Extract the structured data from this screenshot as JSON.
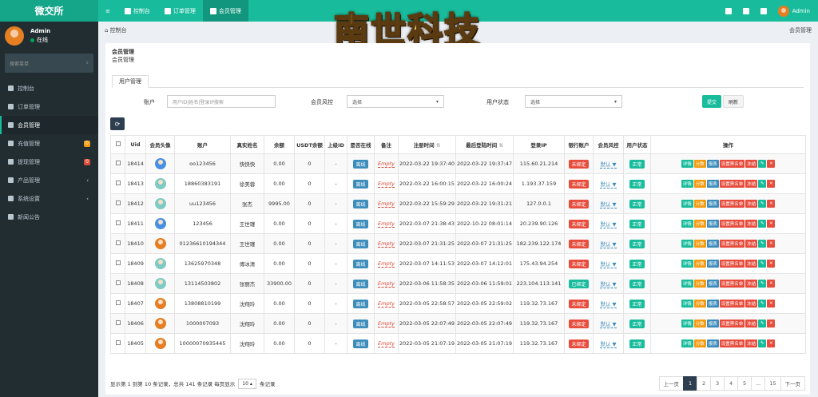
{
  "app": {
    "brand": "微交所"
  },
  "topnav": [
    {
      "label": "≡",
      "icon": "menu-icon"
    },
    {
      "label": "控制台",
      "icon": "dashboard-icon"
    },
    {
      "label": "订单管理",
      "icon": "list-icon"
    },
    {
      "label": "会员管理",
      "icon": "users-icon",
      "active": true
    }
  ],
  "topright": {
    "username": "Admin"
  },
  "sidebar": {
    "user": {
      "name": "Admin",
      "status": "在线"
    },
    "search_placeholder": "搜索菜单",
    "items": [
      {
        "label": "控制台",
        "icon": "dashboard-icon"
      },
      {
        "label": "订单管理",
        "icon": "list-icon"
      },
      {
        "label": "会员管理",
        "icon": "users-icon",
        "active": true
      },
      {
        "label": "充值管理",
        "icon": "cash-icon",
        "badge": "0",
        "badge_color": "#f39c12"
      },
      {
        "label": "提现管理",
        "icon": "withdraw-icon",
        "badge": "0",
        "badge_color": "#dd4b39"
      },
      {
        "label": "产品管理",
        "icon": "product-icon",
        "chevron": "‹"
      },
      {
        "label": "系统设置",
        "icon": "gear-icon",
        "chevron": "‹"
      },
      {
        "label": "新闻公告",
        "icon": "news-icon"
      }
    ]
  },
  "breadcrumb": {
    "left": "控制台",
    "right": "会员管理"
  },
  "panel": {
    "title": "会员管理",
    "subtitle": "会员管理",
    "tab": "用户管理"
  },
  "filters": {
    "account_label": "账户",
    "account_placeholder": "用户ID|姓名|登录IP搜索",
    "risk_label": "会员风控",
    "risk_value": "选择",
    "status_label": "用户状态",
    "status_value": "选择",
    "submit": "提交",
    "reset": "刷新"
  },
  "table": {
    "columns": [
      "",
      "Uid",
      "会员头像",
      "账户",
      "真实姓名",
      "余额",
      "USDT余额",
      "上级ID",
      "是否在线",
      "备注",
      "注册时间",
      "最后登陆时间",
      "登录IP",
      "银行账户",
      "会员风控",
      "用户状态",
      "操作"
    ],
    "rows": [
      {
        "uid": "18414",
        "avatar": "blue",
        "account": "oo123456",
        "name": "快快快",
        "balance": "0.00",
        "usdt": "0",
        "parent": "-",
        "online": "离线",
        "note": "Empty",
        "reg": "2022-03-22 19:37:40",
        "last": "2022-03-22 19:37:47",
        "ip": "115.60.21.214",
        "bank": "未绑定",
        "bank_color": "red",
        "risk": "默认 ▼",
        "status": "正常"
      },
      {
        "uid": "18413",
        "avatar": "teal",
        "account": "18860383191",
        "name": "徐美蓉",
        "balance": "0.00",
        "usdt": "0",
        "parent": "-",
        "online": "离线",
        "note": "Empty",
        "reg": "2022-03-22 16:00:15",
        "last": "2022-03-22 16:00:24",
        "ip": "1.193.37.159",
        "bank": "未绑定",
        "bank_color": "red",
        "risk": "默认 ▼",
        "status": "正常"
      },
      {
        "uid": "18412",
        "avatar": "teal",
        "account": "uu123456",
        "name": "张杰",
        "balance": "9995.00",
        "usdt": "0",
        "parent": "-",
        "online": "离线",
        "note": "Empty",
        "reg": "2022-03-22 15:59:29",
        "last": "2022-03-22 19:31:21",
        "ip": "127.0.0.1",
        "bank": "未绑定",
        "bank_color": "red",
        "risk": "默认 ▼",
        "status": "正常"
      },
      {
        "uid": "18411",
        "avatar": "blue",
        "account": "123456",
        "name": "王世瑾",
        "balance": "0.00",
        "usdt": "0",
        "parent": "-",
        "online": "离线",
        "note": "Empty",
        "reg": "2022-03-07 21:38:43",
        "last": "2022-10-22 08:01:14",
        "ip": "20.239.90.126",
        "bank": "未绑定",
        "bank_color": "red",
        "risk": "默认 ▼",
        "status": "正常"
      },
      {
        "uid": "18410",
        "avatar": "orange",
        "account": "01236610194344",
        "name": "王世瑾",
        "balance": "0.00",
        "usdt": "0",
        "parent": "-",
        "online": "离线",
        "note": "Empty",
        "reg": "2022-03-07 21:31:25",
        "last": "2022-03-07 21:31:25",
        "ip": "182.239.122.174",
        "bank": "未绑定",
        "bank_color": "red",
        "risk": "默认 ▼",
        "status": "正常"
      },
      {
        "uid": "18409",
        "avatar": "teal",
        "account": "13625970348",
        "name": "傅冰清",
        "balance": "0.00",
        "usdt": "0",
        "parent": "-",
        "online": "离线",
        "note": "Empty",
        "reg": "2022-03-07 14:11:53",
        "last": "2022-03-07 14:12:01",
        "ip": "175.43.94.254",
        "bank": "未绑定",
        "bank_color": "red",
        "risk": "默认 ▼",
        "status": "正常"
      },
      {
        "uid": "18408",
        "avatar": "teal",
        "account": "13114503802",
        "name": "张丽杰",
        "balance": "33900.00",
        "usdt": "0",
        "parent": "-",
        "online": "离线",
        "note": "Empty",
        "reg": "2022-03-06 11:58:35",
        "last": "2022-03-06 11:59:01",
        "ip": "223.104.113.141",
        "bank": "已绑定",
        "bank_color": "green",
        "risk": "默认 ▼",
        "status": "正常"
      },
      {
        "uid": "18407",
        "avatar": "orange",
        "account": "13808810199",
        "name": "沈翔玲",
        "balance": "0.00",
        "usdt": "0",
        "parent": "-",
        "online": "离线",
        "note": "Empty",
        "reg": "2022-03-05 22:58:57",
        "last": "2022-03-05 22:59:02",
        "ip": "119.32.73.167",
        "bank": "未绑定",
        "bank_color": "red",
        "risk": "默认 ▼",
        "status": "正常"
      },
      {
        "uid": "18406",
        "avatar": "orange",
        "account": "1000007093",
        "name": "沈翔玲",
        "balance": "0.00",
        "usdt": "0",
        "parent": "-",
        "online": "离线",
        "note": "Empty",
        "reg": "2022-03-05 22:07:49",
        "last": "2022-03-05 22:07:49",
        "ip": "119.32.73.167",
        "bank": "未绑定",
        "bank_color": "red",
        "risk": "默认 ▼",
        "status": "正常"
      },
      {
        "uid": "18405",
        "avatar": "orange",
        "account": "10000070935445",
        "name": "沈翔玲",
        "balance": "0.00",
        "usdt": "0",
        "parent": "-",
        "online": "离线",
        "note": "Empty",
        "reg": "2022-03-05 21:07:19",
        "last": "2022-03-05 21:07:19",
        "ip": "119.32.73.167",
        "bank": "未绑定",
        "bank_color": "red",
        "risk": "默认 ▼",
        "status": "正常"
      }
    ],
    "actions": [
      {
        "label": "详情",
        "color": "green"
      },
      {
        "label": "分数",
        "color": "orange"
      },
      {
        "label": "报表",
        "color": "blue"
      },
      {
        "label": "设置黑名单",
        "color": "red"
      },
      {
        "label": "冻结",
        "color": "red"
      }
    ]
  },
  "footer": {
    "summary_pre": "显示第 1 到第 10 条记录，总共 141 条记录 每页显示",
    "page_size": "10",
    "summary_post": "条记录",
    "pager": [
      "上一页",
      "1",
      "2",
      "3",
      "4",
      "5",
      "...",
      "15",
      "下一页"
    ],
    "active_page": "1"
  },
  "logo": {
    "text": "南世科技"
  }
}
